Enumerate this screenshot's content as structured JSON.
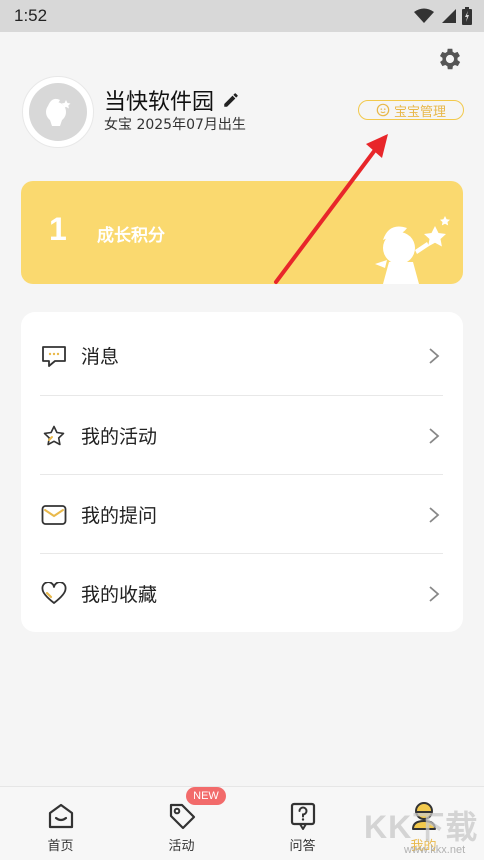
{
  "status_bar": {
    "time": "1:52",
    "icons": [
      "wifi-icon",
      "signal-icon",
      "battery-icon"
    ]
  },
  "header": {
    "settings_icon": "gear-icon"
  },
  "profile": {
    "username": "当快软件园",
    "edit_icon": "pencil-icon",
    "birth_info": "女宝 2025年07月出生",
    "baby_management_label": "宝宝管理"
  },
  "points_card": {
    "value": "1",
    "label": "成长积分",
    "background": "#fad96f"
  },
  "menu": {
    "items": [
      {
        "label": "消息",
        "icon": "message-icon"
      },
      {
        "label": "我的活动",
        "icon": "star-icon"
      },
      {
        "label": "我的提问",
        "icon": "envelope-icon"
      },
      {
        "label": "我的收藏",
        "icon": "heart-icon"
      }
    ]
  },
  "tabbar": {
    "tabs": [
      {
        "label": "首页",
        "icon": "home-icon"
      },
      {
        "label": "活动",
        "icon": "tag-icon",
        "badge": "NEW"
      },
      {
        "label": "问答",
        "icon": "question-icon"
      },
      {
        "label": "我的",
        "icon": "profile-icon",
        "active": true
      }
    ],
    "active_color": "#e9b94b"
  },
  "watermark": {
    "main": "KK下载",
    "sub": "www.kkx.net"
  }
}
